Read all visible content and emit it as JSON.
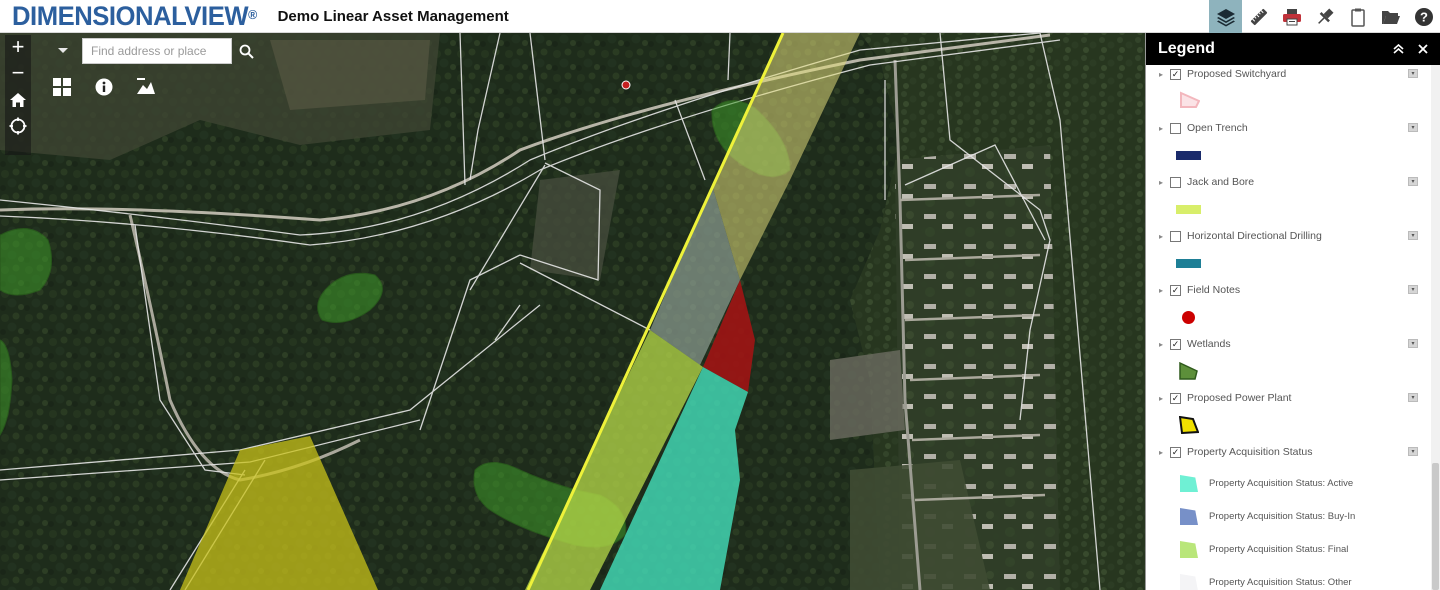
{
  "header": {
    "brand_main": "DIMENSIONALVIEW",
    "brand_reg": "®",
    "app_title": "Demo Linear Asset Management",
    "tools": [
      {
        "icon": "layers-icon",
        "active": true
      },
      {
        "icon": "ruler-icon",
        "active": false
      },
      {
        "icon": "print-icon",
        "active": false
      },
      {
        "icon": "pin-icon",
        "active": false
      },
      {
        "icon": "clipboard-icon",
        "active": false
      },
      {
        "icon": "folder-open-icon",
        "active": false
      },
      {
        "icon": "help-icon",
        "active": false
      }
    ]
  },
  "map_controls": {
    "zoom_in": "+",
    "zoom_out": "−",
    "search_placeholder": "Find address or place",
    "icons": [
      "home-icon",
      "locate-icon",
      "basemap-grid-icon",
      "info-icon",
      "scale-icon"
    ]
  },
  "legend": {
    "title": "Legend",
    "items": [
      {
        "label": "Proposed Switchyard",
        "checked": true,
        "swatch": {
          "type": "polygon-outline",
          "color": "#f3b7bd"
        }
      },
      {
        "label": "Open Trench",
        "checked": false,
        "swatch": {
          "type": "line",
          "color": "#1a2b6b"
        }
      },
      {
        "label": "Jack and Bore",
        "checked": false,
        "swatch": {
          "type": "line",
          "color": "#d8ee6a"
        }
      },
      {
        "label": "Horizontal Directional Drilling",
        "checked": false,
        "swatch": {
          "type": "line",
          "color": "#1e7f96"
        }
      },
      {
        "label": "Field Notes",
        "checked": true,
        "swatch": {
          "type": "point",
          "color": "#cc0000"
        }
      },
      {
        "label": "Wetlands",
        "checked": true,
        "swatch": {
          "type": "polygon",
          "color": "#5d8f3a"
        }
      },
      {
        "label": "Proposed Power Plant",
        "checked": true,
        "swatch": {
          "type": "polygon",
          "color": "#f0e000"
        }
      },
      {
        "label": "Property Acquisition Status",
        "checked": true,
        "swatch": null
      }
    ],
    "sub_items": [
      {
        "label": "Property Acquisition Status: Active",
        "color": "#6ff0d4"
      },
      {
        "label": "Property Acquisition Status: Buy-In",
        "color": "#7790c8"
      },
      {
        "label": "Property Acquisition Status: Final",
        "color": "#b9e67a"
      },
      {
        "label": "Property Acquisition Status: Other",
        "color": "#f4f4f6"
      }
    ]
  },
  "colors": {
    "brand_blue": "#2c5f9e",
    "active_tool": "#8eb3bd",
    "corridor_yellow_line": "#eef23a",
    "acquisition_active": "#44e0bb",
    "acquisition_final": "#b7d94a",
    "power_plant": "#c8c21a",
    "field_red": "#a01414",
    "wetland_green": "#3f9a2a"
  }
}
